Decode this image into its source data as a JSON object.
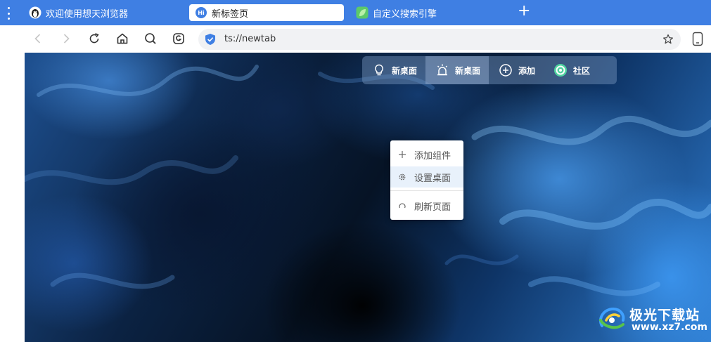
{
  "tabs": [
    {
      "label": "欢迎使用想天浏览器",
      "active": false
    },
    {
      "label": "新标签页",
      "active": true
    },
    {
      "label": "自定义搜索引擎",
      "active": false
    }
  ],
  "new_tab_label": "+",
  "address": {
    "url": "ts://newtab"
  },
  "widget_bar": [
    {
      "label": "新桌面",
      "icon": "lightbulb-icon"
    },
    {
      "label": "新桌面",
      "icon": "alarm-light-icon",
      "selected": true
    },
    {
      "label": "添加",
      "icon": "plus-circle-icon"
    },
    {
      "label": "社区",
      "icon": "community-icon"
    }
  ],
  "context_menu": [
    {
      "label": "添加组件",
      "icon": "plus-icon"
    },
    {
      "label": "设置桌面",
      "icon": "gear-icon"
    },
    {
      "label": "刷新页面",
      "icon": "refresh-icon"
    }
  ],
  "watermark": {
    "title": "极光下载站",
    "url": "www.xz7.com"
  },
  "colors": {
    "tabbar": "#3f7fe3",
    "accent": "#3f7fe3",
    "menu_hover": "#e8f1fb"
  }
}
